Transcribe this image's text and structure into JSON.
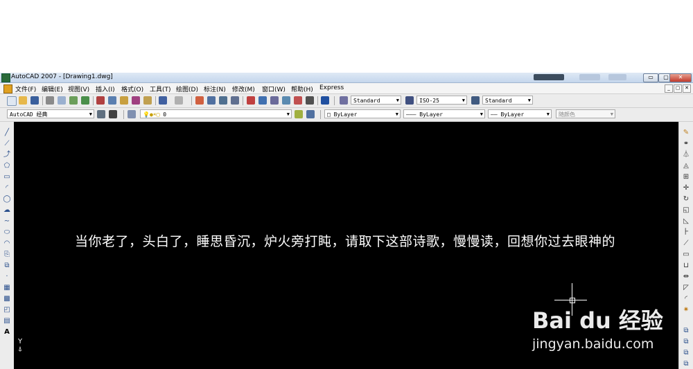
{
  "window": {
    "title": "AutoCAD 2007 - [Drawing1.dwg]",
    "buttons": [
      "▭",
      "▢",
      "✕"
    ]
  },
  "menubar": {
    "items": [
      "文件(F)",
      "编辑(E)",
      "视图(V)",
      "插入(I)",
      "格式(O)",
      "工具(T)",
      "绘图(D)",
      "标注(N)",
      "修改(M)",
      "窗口(W)",
      "帮助(H)",
      "Express"
    ],
    "mdi_buttons": [
      "_",
      "▢",
      "✕"
    ]
  },
  "toolbar1": {
    "text_style": "Standard",
    "dim_style": "ISO-25",
    "table_style": "Standard"
  },
  "toolbar2": {
    "workspace": "AutoCAD 经典",
    "layer": "0",
    "color": "ByLayer",
    "linetype": "ByLayer",
    "lineweight": "ByLayer",
    "plotstyle": "随颜色"
  },
  "canvas": {
    "text": "当你老了，头白了，睡思昏沉，炉火旁打盹，请取下这部诗歌，慢慢读，回想你过去眼神的",
    "ucs_label": "Y",
    "watermark_logo": "Bai du 经验",
    "watermark_url": "jingyan.baidu.com"
  },
  "colors": {
    "canvas_bg": "#000000",
    "text": "#ffffff",
    "chrome": "#ececec"
  }
}
